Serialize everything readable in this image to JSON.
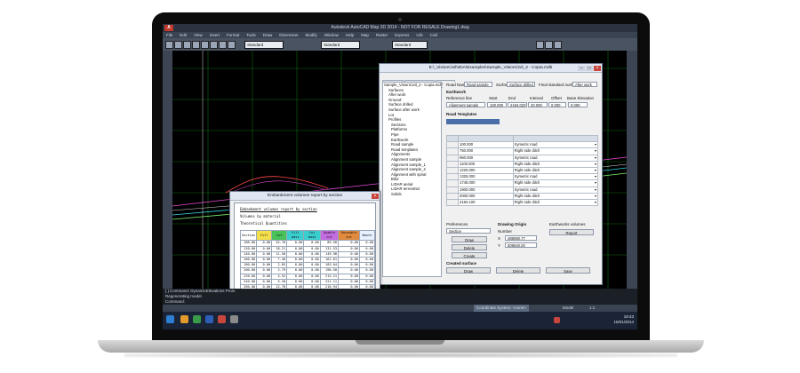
{
  "colors": {
    "drawing_bg": "#000000",
    "grid_green": "#0f6b0f",
    "line_red": "#ff4a4a",
    "line_magenta": "#e64ad8",
    "line_cyan": "#35d4e0",
    "line_lime": "#7df06a",
    "line_white": "#d8d8d8",
    "header_fill": "#e6f0ff",
    "fill_cell": "#f5e04a",
    "cut_cell": "#49c25a",
    "mass_cell": "#3acfcf",
    "ucut": "#c36be0",
    "udx": "#e28a3c"
  },
  "acad": {
    "title": "Autodesk AutoCAD Map 3D 2014 - NOT FOR RESALE  Drawing1.dwg",
    "menu": [
      "File",
      "Edit",
      "View",
      "Insert",
      "Format",
      "Tools",
      "Draw",
      "Dimension",
      "Modify",
      "Window",
      "Help",
      "Map",
      "Raster",
      "Express",
      "Urb",
      "Civil"
    ],
    "style_select": "Standard",
    "layer_select": "Standard",
    "dim_select": "Standard",
    "cmd_lines": [
      "[ ] Command: DynamicElevations Prom",
      "Regenerating model.",
      "Command:"
    ],
    "status": {
      "coordinate_system": "Coordinate System: <none>",
      "model": "Model",
      "scale": "1:1"
    },
    "clock": {
      "time": "18:43",
      "date": "15/01/2014"
    }
  },
  "roadwin": {
    "title": "E:\\_VisionCivil\\3DA\\Examples\\Sample_VisionCivil_2 - Copia.mdb",
    "tabs": [
      "Project",
      "Preferences",
      "About"
    ],
    "tree": [
      "Sample_VisionCivil_2 - Copia.mdb",
      "Surfaces",
      "After work",
      "Ground",
      "Surface drilled",
      "Surface after work",
      "Lot",
      "Profiles",
      "Sections",
      "Platforms",
      "Pipe",
      "Earthwork",
      "Road sample",
      "Road templates",
      "Alignments",
      "Alignment sample",
      "Alignment sample_1",
      "Alignment sample_2",
      "Alignment with spiral",
      "Bifur",
      "LIDAR aerial",
      "LIDAR terrestrial",
      "Solids"
    ],
    "road_name_label": "Road Name",
    "road_name_value": "Road sample",
    "surface_label": "Surface",
    "surface_value": "Surface drilled",
    "final_surface_label": "Final standard surface",
    "final_surface_value": "After work",
    "earthwork_label": "Earthwork",
    "reference_label": "Reference line",
    "start_label": "Start",
    "end_label": "End",
    "interval_label": "Interval",
    "offset_label": "Offset",
    "base_elev_label": "Base Elevation",
    "reference_value": "Alignment sample",
    "start_value": "100.000",
    "end_value": "2184.020",
    "interval_value": "20.000",
    "offset_value": "0.000",
    "base_elev_value": "0.000",
    "templates_label": "Road Templates",
    "templates": [
      {
        "station": "100.000",
        "type": "Symetric road"
      },
      {
        "station": "750.000",
        "type": "Right side ditch"
      },
      {
        "station": "960.000",
        "type": "Symetric road"
      },
      {
        "station": "1100.000",
        "type": "Right side ditch"
      },
      {
        "station": "1220.000",
        "type": "Right side ditch"
      },
      {
        "station": "1325.000",
        "type": "Symetric road"
      },
      {
        "station": "1745.000",
        "type": "Right side ditch"
      },
      {
        "station": "1900.000",
        "type": "Symetric road"
      },
      {
        "station": "2000.000",
        "type": "Right side ditch"
      },
      {
        "station": "2184.100",
        "type": "Right side ditch"
      }
    ],
    "preferences_label": "Preferences",
    "preferences_value": "Section",
    "drawing_origin_label": "Drawing Origin",
    "number_label": "Number",
    "x_label": "X",
    "y_label": "Y",
    "x_value": "489080.77",
    "y_value": "509640.00",
    "earthworks_volumes_label": "Earthworks volumes",
    "report_button": "Report",
    "draw_button": "Draw",
    "delete_button": "Delete",
    "create_button": "Create",
    "created_surface_label": "Created surface",
    "save_button": "Save"
  },
  "reportwin": {
    "title": "Embankment volumes report by section",
    "heading": "Embankment volumes report by section",
    "line2": "Volumes by material",
    "line3": "Theoretical Quantities",
    "headers": [
      "Section",
      "Fill",
      "Cut",
      "Fill mass",
      "Cut mass",
      "Usable cut",
      "Unusable cut",
      "Waste"
    ],
    "rows": [
      [
        "100.00",
        "0.00",
        "52.70",
        "0.00",
        "0.00",
        "89.58",
        "0.00",
        "0.00"
      ],
      [
        "120.00",
        "0.00",
        "18.21",
        "0.00",
        "0.00",
        "131.53",
        "0.00",
        "0.00"
      ],
      [
        "140.00",
        "0.00",
        "11.50",
        "0.00",
        "0.00",
        "149.98",
        "0.00",
        "0.00"
      ],
      [
        "160.00",
        "0.00",
        "7.40",
        "0.00",
        "0.00",
        "161.61",
        "0.00",
        "0.00"
      ],
      [
        "180.00",
        "0.00",
        "2.85",
        "0.00",
        "0.00",
        "183.04",
        "0.00",
        "0.00"
      ],
      [
        "200.00",
        "0.00",
        "2.79",
        "0.00",
        "0.00",
        "190.50",
        "0.00",
        "0.00"
      ],
      [
        "220.00",
        "0.00",
        "4.52",
        "0.00",
        "0.00",
        "213.21",
        "0.00",
        "0.00"
      ],
      [
        "240.00",
        "0.00",
        "5.30",
        "0.00",
        "0.00",
        "221.11",
        "0.00",
        "0.00"
      ],
      [
        "260.00",
        "0.00",
        "12.78",
        "0.00",
        "0.00",
        "216.94",
        "0.00",
        "0.00"
      ],
      [
        "280.00",
        "0.00",
        "11.90",
        "0.00",
        "0.00",
        "225.13",
        "0.00",
        "0.00"
      ],
      [
        "300.00",
        "0.00",
        "10.66",
        "0.00",
        "0.00",
        "263.44",
        "0.00",
        "0.00"
      ]
    ],
    "search_label": "Search",
    "file_value": "Sample_VisionCivil_2 - Copia.earthworks.volumes.htm",
    "save_button": "Save",
    "cancel_button": "Cancel"
  }
}
